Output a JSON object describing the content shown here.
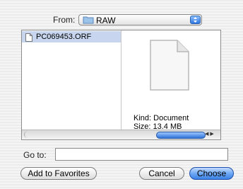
{
  "dialog": {
    "from_label": "From:",
    "location": "RAW",
    "file_list": [
      {
        "name": "PC069453.ORF"
      }
    ],
    "preview": {
      "kind": "Kind: Document",
      "size": "Size: 13.4 MB"
    },
    "goto_label": "Go to:",
    "goto_value": "",
    "buttons": {
      "add_favorites": "Add to Favorites",
      "cancel": "Cancel",
      "choose": "Choose"
    }
  }
}
